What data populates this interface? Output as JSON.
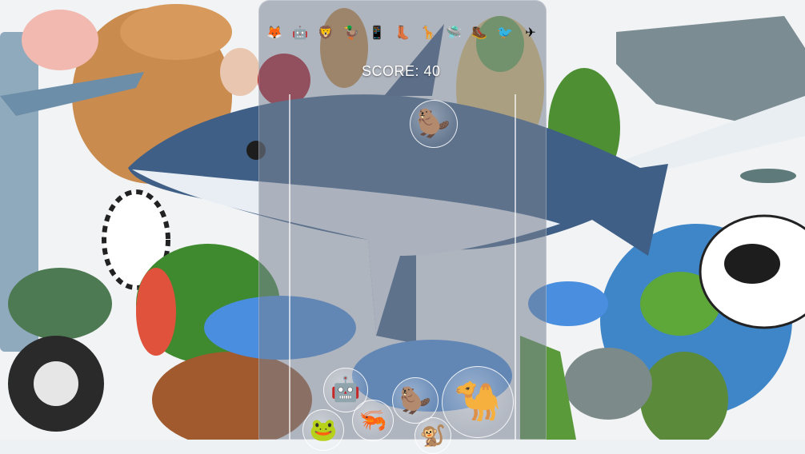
{
  "game": {
    "score_text": "SCORE: 40"
  },
  "next_items": [
    {
      "name": "fox-icon",
      "glyph": "🦊"
    },
    {
      "name": "robot-icon",
      "glyph": "🤖"
    },
    {
      "name": "lion-icon",
      "glyph": "🦁"
    },
    {
      "name": "duck-icon",
      "glyph": "🦆"
    },
    {
      "name": "phone-icon",
      "glyph": "📱"
    },
    {
      "name": "boot-icon",
      "glyph": "👢"
    },
    {
      "name": "giraffe-icon",
      "glyph": "🦒"
    },
    {
      "name": "ufo-icon",
      "glyph": "🛸"
    },
    {
      "name": "boot-brown-icon",
      "glyph": "🥾"
    },
    {
      "name": "bird-icon",
      "glyph": "🐦"
    },
    {
      "name": "airplane-icon",
      "glyph": "✈"
    }
  ],
  "balls": [
    {
      "name": "capybara-ball",
      "glyph": "🦫"
    },
    {
      "name": "robot-ball",
      "glyph": "🤖"
    },
    {
      "name": "frog-ball",
      "glyph": "🐸"
    },
    {
      "name": "shrimp-ball",
      "glyph": "🦐"
    },
    {
      "name": "capybara-ball",
      "glyph": "🦫"
    },
    {
      "name": "camel-ball",
      "glyph": "🐪"
    },
    {
      "name": "monkey-ball",
      "glyph": "🐒"
    }
  ],
  "colors": {
    "panel": "#7a8291",
    "shark": "#3f5f86",
    "shoe": "#4a8ee0"
  }
}
